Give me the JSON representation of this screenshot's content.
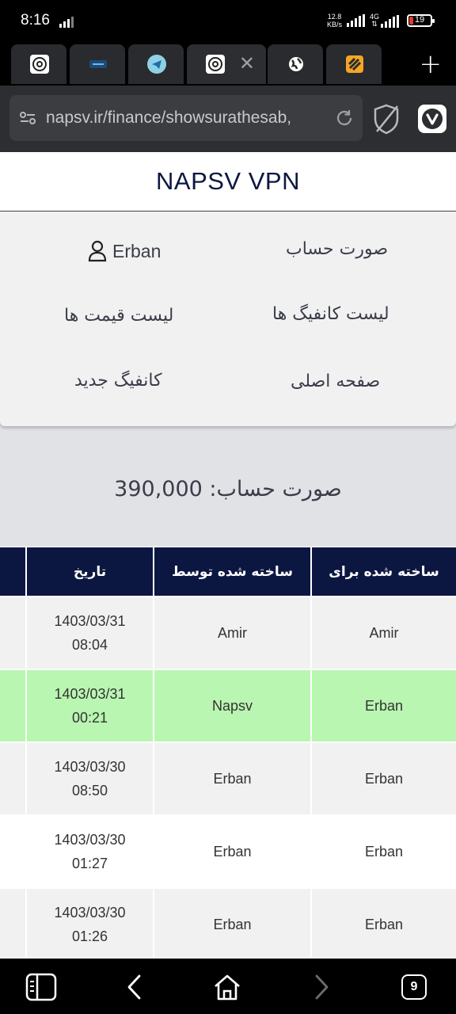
{
  "status_bar": {
    "time": "8:16",
    "net_speed_value": "12.8",
    "net_speed_unit": "KB/s",
    "network_type": "4G",
    "battery_level": "19",
    "battery_fraction": 0.19
  },
  "tabs": {
    "items": [
      {
        "icon": "napsv-favicon"
      },
      {
        "icon": "dark-site-favicon"
      },
      {
        "icon": "telegram-favicon"
      },
      {
        "icon": "napsv-favicon",
        "active": true,
        "close_label": "✕"
      },
      {
        "icon": "globe-favicon"
      },
      {
        "icon": "orange-app-favicon"
      }
    ],
    "new_tab_label": "+"
  },
  "address_bar": {
    "url": "napsv.ir/finance/showsurathesab,"
  },
  "site": {
    "title": "NAPSV VPN"
  },
  "menu": {
    "user_name": "Erban",
    "invoice": "صورت حساب",
    "price_list": "لیست قیمت ها",
    "config_list": "لیست کانفیگ ها",
    "new_config": "کانفیگ جدید",
    "home": "صفحه اصلی"
  },
  "balance": {
    "label": "صورت حساب:",
    "amount": "390,000"
  },
  "table": {
    "headers": {
      "created_for": "ساخته شده برای",
      "created_by": "ساخته شده توسط",
      "date": "تاریخ"
    },
    "rows": [
      {
        "created_for": "Amir",
        "created_by": "Amir",
        "date": "1403/03/31",
        "time": "08:04",
        "highlight": false
      },
      {
        "created_for": "Erban",
        "created_by": "Napsv",
        "date": "1403/03/31",
        "time": "00:21",
        "highlight": true
      },
      {
        "created_for": "Erban",
        "created_by": "Erban",
        "date": "1403/03/30",
        "time": "08:50",
        "highlight": false
      },
      {
        "created_for": "Erban",
        "created_by": "Erban",
        "date": "1403/03/30",
        "time": "01:27",
        "highlight": false
      },
      {
        "created_for": "Erban",
        "created_by": "Erban",
        "date": "1403/03/30",
        "time": "01:26",
        "highlight": false
      }
    ]
  },
  "bottom_bar": {
    "tab_count": "9"
  },
  "colors": {
    "header_navy": "#0c1741",
    "highlight_green": "#b9f6b1",
    "row_gray": "#f1f1f1"
  }
}
